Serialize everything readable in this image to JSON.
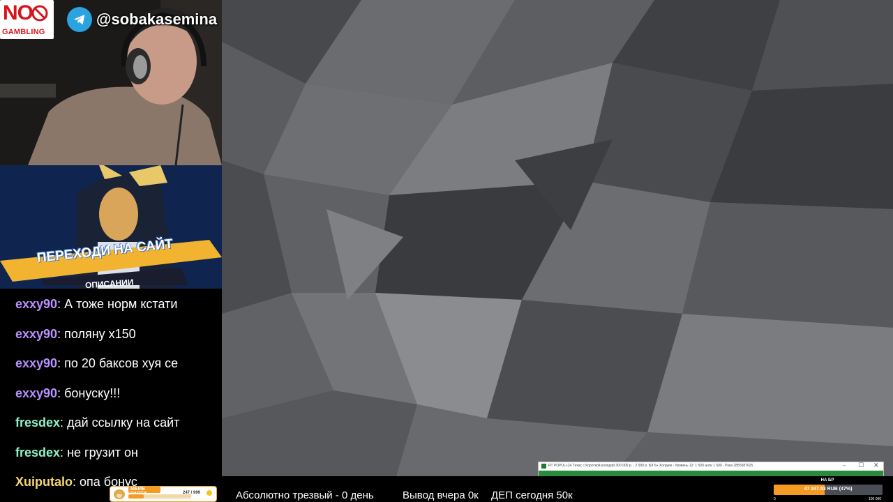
{
  "overlay": {
    "no_gambling_top": "NO",
    "no_gambling_bottom": "GAMBLING",
    "telegram_handle": "@sobakasemina",
    "telegram_icon": "telegram-icon",
    "promo_banner_text": "ПЕРЕХОДИ НА САЙТ",
    "promo_banner_sub": "ОПИСАНИИ"
  },
  "chat": {
    "messages": [
      {
        "user": "exxy90",
        "color": "#b991ff",
        "text": "А тоже норм кстати"
      },
      {
        "user": "exxy90",
        "color": "#b991ff",
        "text": "поляну х150"
      },
      {
        "user": "exxy90",
        "color": "#b991ff",
        "text": "по 20 баксов хуя се"
      },
      {
        "user": "exxy90",
        "color": "#b991ff",
        "text": "бонуску!!!"
      },
      {
        "user": "fresdex",
        "color": "#8ff0c9",
        "text": "дай ссылку на сайт"
      },
      {
        "user": "fresdex",
        "color": "#8ff0c9",
        "text": "не грузит он"
      },
      {
        "user": "Xuiputalo",
        "color": "#f7d774",
        "text": "опа бонус"
      }
    ]
  },
  "meme_party": {
    "label": "MEME PARTY",
    "count": "247 / 999",
    "progress": 0.247
  },
  "bottom_bar": {
    "sober": "Абсолютно трезвый - 0 день",
    "withdraw": "Вывод вчера 0к",
    "deposit": "ДЕП сегодня 50к"
  },
  "poker_window": {
    "title": "RT POPULI-24 Техас с Короткой колодой 300 000 р. - 2 000 р. БЛ 6+ Холдем - Уровень 12: 1 500 анте 1 500 - Рука 2855587625",
    "minimize": "–",
    "maximize": "☐",
    "close": "✕"
  },
  "br_tracker": {
    "label": "НА БР",
    "value": "47 247.53 RUB (47%)",
    "progress": 0.47,
    "min": "0",
    "max": "100 000"
  },
  "colors": {
    "stage_bg": "#55575a",
    "telegram": "#2aa3df",
    "brand_red": "#d6141c",
    "progress_orange": "#f59a23"
  }
}
